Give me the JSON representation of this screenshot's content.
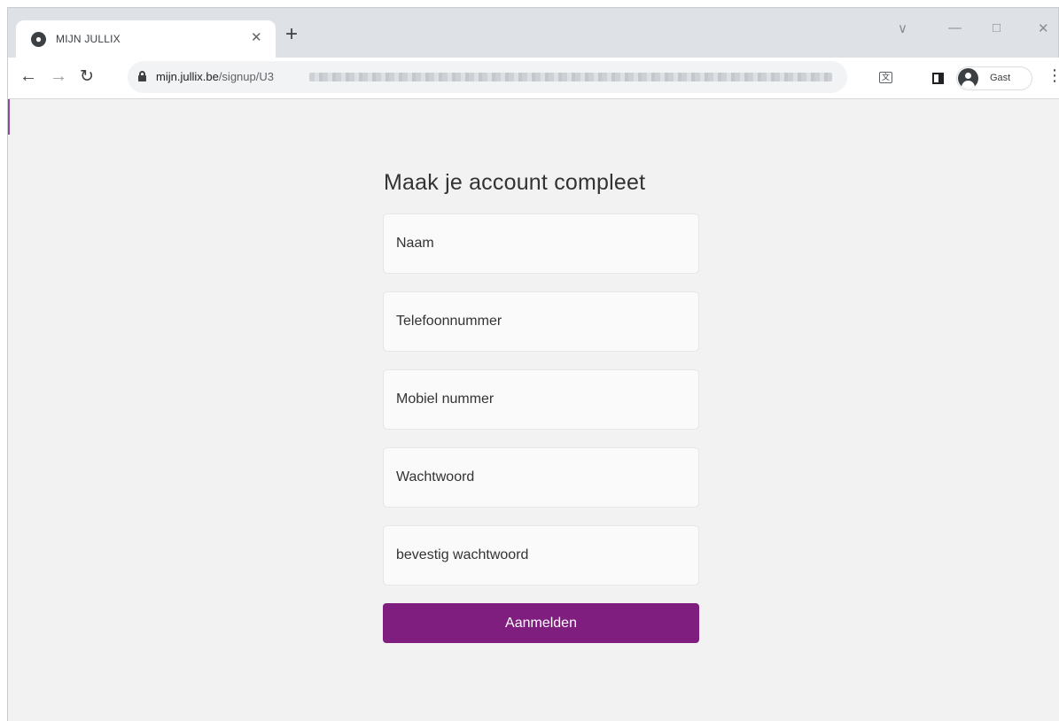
{
  "browser": {
    "tab": {
      "favicon": "globe-icon",
      "title": "MIJN JULLIX"
    },
    "url": {
      "domain": "mijn.jullix.be",
      "path": "/signup/U3"
    },
    "profile": {
      "label": "Gast"
    },
    "icons": {
      "back": "back-arrow-icon",
      "forward": "forward-arrow-icon",
      "reload": "reload-icon",
      "lock": "lock-icon",
      "translate": "translate-icon",
      "side_panel": "side-panel-icon",
      "menu": "kebab-menu-icon"
    }
  },
  "form": {
    "title": "Maak je account compleet",
    "fields": {
      "name": "Naam",
      "phone": "Telefoonnummer",
      "mobile": "Mobiel nummer",
      "password": "Wachtwoord",
      "confirm_password": "bevestig wachtwoord"
    },
    "submit_label": "Aanmelden"
  },
  "colors": {
    "page_background": "#f2f2f2",
    "field_background": "#fafafa",
    "button_background": "#7f1e7e",
    "button_text": "#ffffff"
  }
}
